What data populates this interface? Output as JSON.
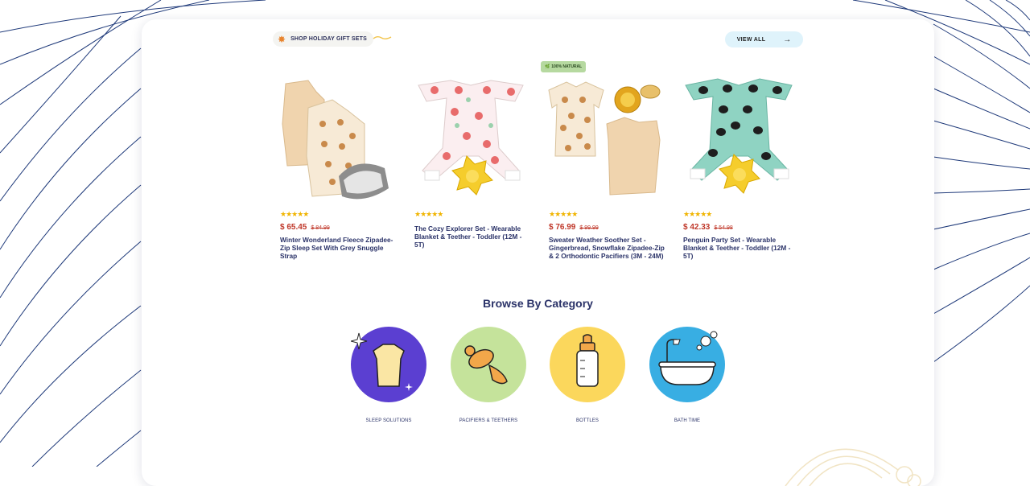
{
  "header": {
    "section_label": "SHOP HOLIDAY GIFT SETS",
    "view_all": "VIEW ALL",
    "badge": "100% NATURAL"
  },
  "products": [
    {
      "rating": "★★★★★",
      "price": "$ 65.45",
      "old_price": "$ 84.99",
      "title": "Winter Wonderland Fleece Zipadee-Zip Sleep Set With Grey Snuggle Strap"
    },
    {
      "rating": "★★★★★",
      "price": "",
      "old_price": "",
      "title": "The Cozy Explorer Set - Wearable Blanket & Teether - Toddler (12M - 5T)"
    },
    {
      "rating": "★★★★★",
      "price": "$ 76.99",
      "old_price": "$ 99.99",
      "title": "Sweater Weather Soother Set - Gingerbread, Snowflake Zipadee-Zip & 2 Orthodontic Pacifiers (3M - 24M)"
    },
    {
      "rating": "★★★★★",
      "price": "$ 42.33",
      "old_price": "$ 54.98",
      "title": "Penguin Party Set - Wearable Blanket & Teether - Toddler (12M - 5T)"
    }
  ],
  "browse": {
    "title": "Browse By Category",
    "categories": [
      {
        "label": "SLEEP SOLUTIONS",
        "color": "#5b3fd1"
      },
      {
        "label": "PACIFIERS & TEETHERS",
        "color": "#c5e39b"
      },
      {
        "label": "BOTTLES",
        "color": "#fbd75c"
      },
      {
        "label": "BATH TIME",
        "color": "#38aee3"
      }
    ]
  }
}
